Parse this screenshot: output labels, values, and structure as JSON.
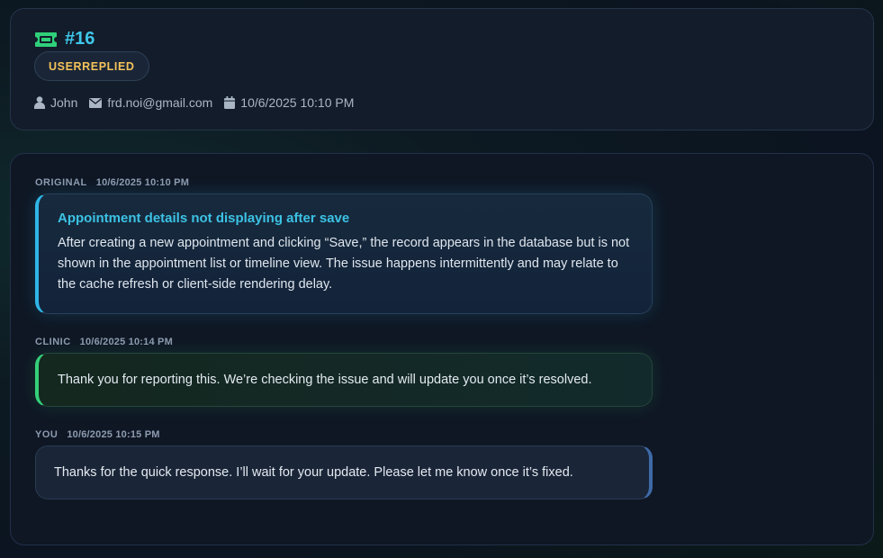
{
  "ticket": {
    "number": "#16",
    "status": "USERREPLIED",
    "author": "John",
    "email": "frd.noi@gmail.com",
    "created": "10/6/2025 10:10 PM"
  },
  "messages": [
    {
      "sender": "ORIGINAL",
      "time": "10/6/2025 10:10 PM",
      "title": "Appointment details not displaying after save",
      "body": "After creating a new appointment and clicking “Save,” the record appears in the database but is not shown in the appointment list or timeline view. The issue happens intermittently and may relate to the cache refresh or client-side rendering delay."
    },
    {
      "sender": "CLINIC",
      "time": "10/6/2025 10:14 PM",
      "body": "Thank you for reporting this. We’re checking the issue and will update you once it’s resolved."
    },
    {
      "sender": "YOU",
      "time": "10/6/2025 10:15 PM",
      "body": "Thanks for the quick response. I’ll wait for your update. Please let me know once it’s fixed."
    }
  ],
  "icons": {
    "ticket": "ticket-icon",
    "user": "user-icon",
    "email": "envelope-icon",
    "date": "calendar-icon"
  },
  "colors": {
    "accent_cyan": "#3ec7ea",
    "status_yellow": "#f4c35a",
    "clinic_green": "#35d07a",
    "you_blue": "#3f6aa8"
  }
}
